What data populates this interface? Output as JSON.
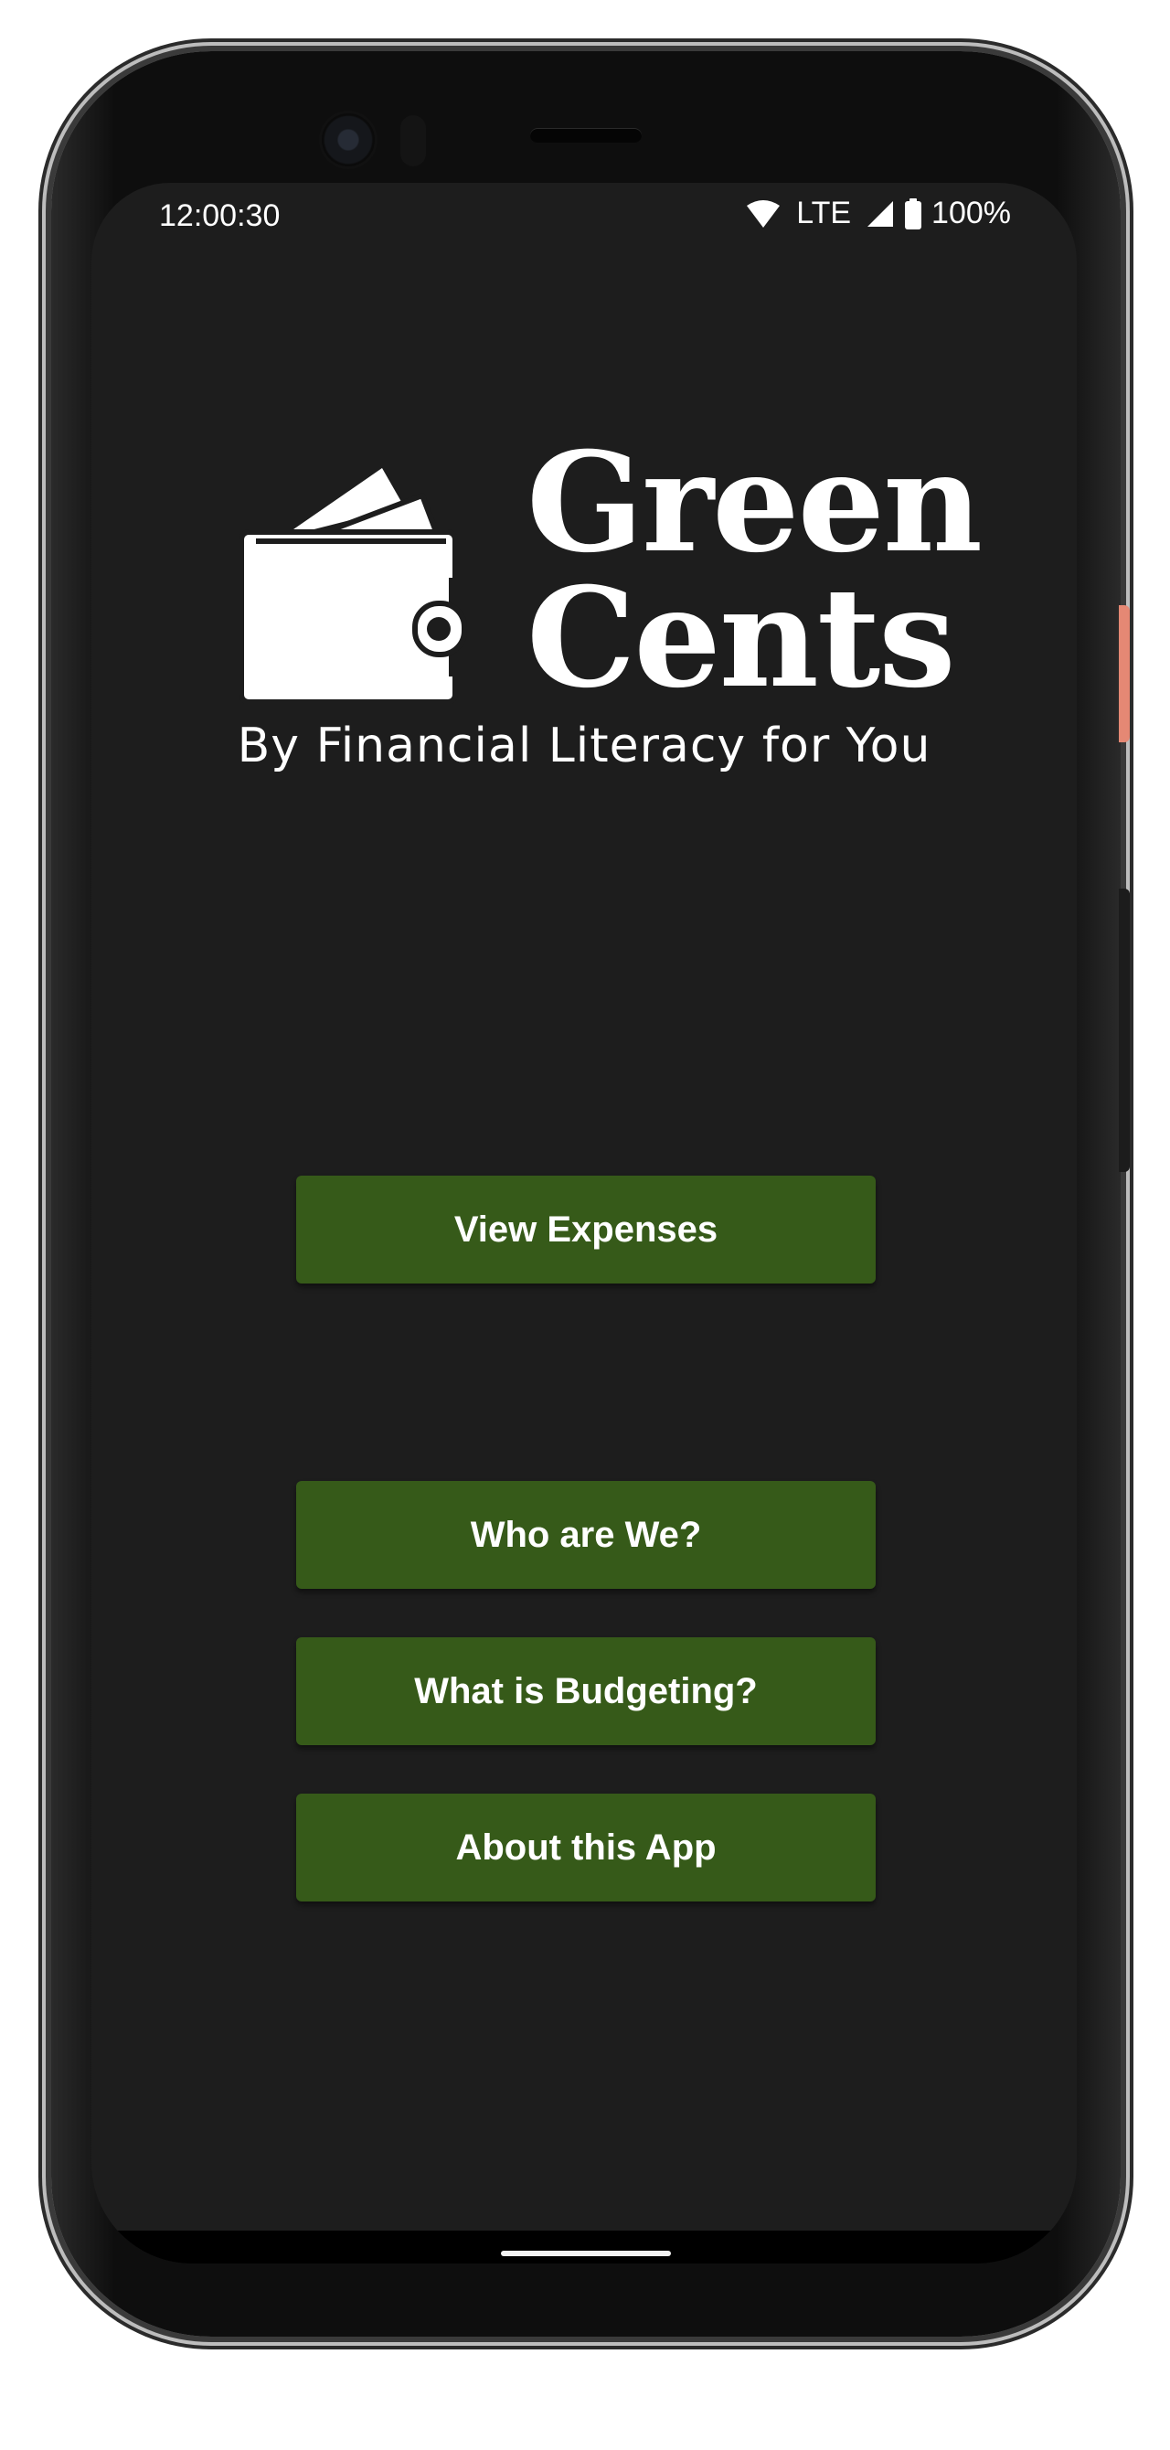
{
  "status_bar": {
    "time": "12:00:30",
    "network": "LTE",
    "battery": "100%",
    "icons": [
      "wifi-icon",
      "signal-icon",
      "battery-icon"
    ]
  },
  "logo": {
    "title_line1": "Green",
    "title_line2": "Cents",
    "icon": "wallet-icon"
  },
  "tagline": "By Financial Literacy for You",
  "buttons": {
    "view_expenses": "View Expenses",
    "who_are_we": "Who are We?",
    "what_is_budgeting": "What is Budgeting?",
    "about_app": "About this App"
  },
  "colors": {
    "background": "#1d1d1d",
    "button": "#365a19",
    "text": "#ffffff"
  }
}
